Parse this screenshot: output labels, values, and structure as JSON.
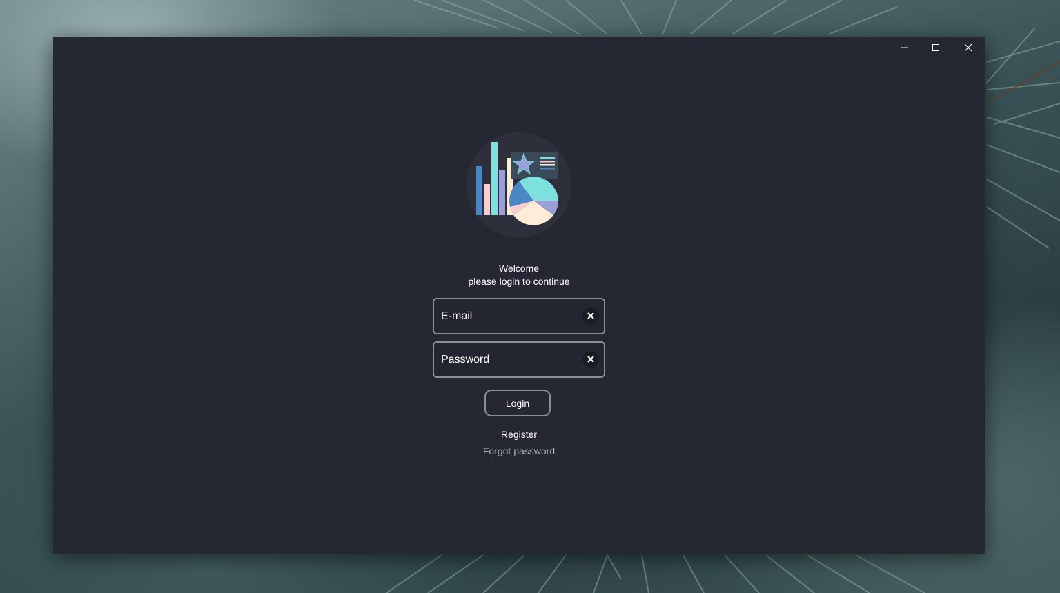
{
  "window": {
    "caption_buttons": {
      "minimize_icon": "minimize-icon",
      "maximize_icon": "maximize-icon",
      "close_icon": "close-icon"
    },
    "background_color": "#252833"
  },
  "login": {
    "logo_icon": "analytics-charts-icon",
    "welcome_line1": "Welcome",
    "welcome_line2": "please login to continue",
    "email": {
      "placeholder": "E-mail",
      "value": "",
      "clear_icon": "clear-x-icon"
    },
    "password": {
      "placeholder": "Password",
      "value": "",
      "clear_icon": "clear-x-icon"
    },
    "login_label": "Login",
    "register_label": "Register",
    "forgot_label": "Forgot password"
  },
  "colors": {
    "text_primary": "#ffffff",
    "text_muted": "#a9acb3",
    "border": "#8b8e97",
    "logo_teal": "#7fe0e0",
    "logo_blue": "#4a87c4",
    "logo_pink": "#f6cfd6",
    "logo_lavender": "#9a9fd9",
    "logo_cream": "#fdecd6"
  }
}
